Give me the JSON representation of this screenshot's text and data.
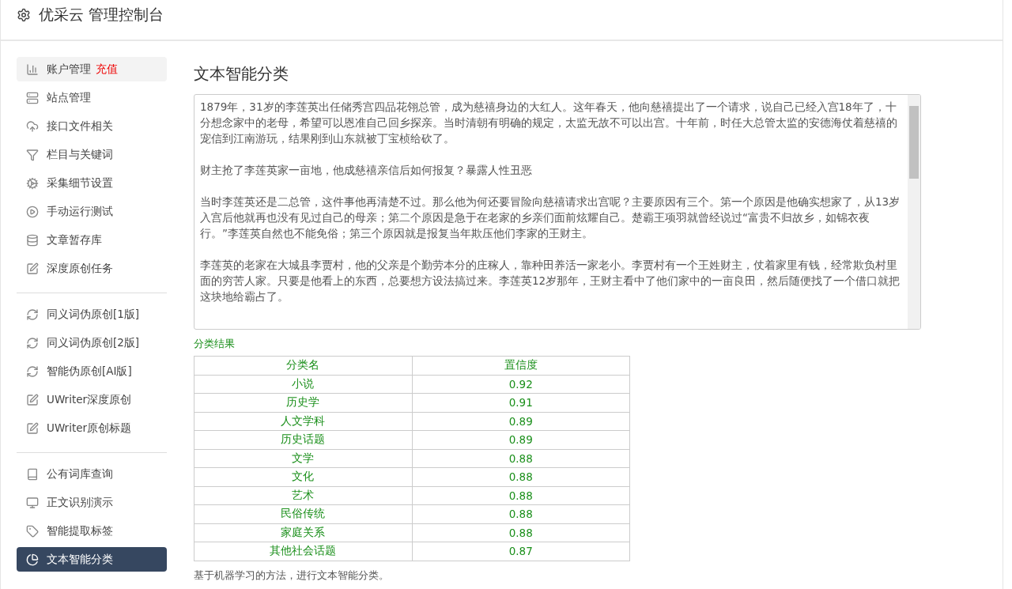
{
  "header": {
    "title": "优采云 管理控制台"
  },
  "sidebar": {
    "groups": [
      [
        {
          "label": "账户管理",
          "badge": "充值",
          "selected": false,
          "highlighted": true
        },
        {
          "label": "站点管理",
          "selected": false,
          "highlighted": false
        },
        {
          "label": "接口文件相关",
          "selected": false,
          "highlighted": false
        },
        {
          "label": "栏目与关键词",
          "selected": false,
          "highlighted": false
        },
        {
          "label": "采集细节设置",
          "selected": false,
          "highlighted": false
        },
        {
          "label": "手动运行测试",
          "selected": false,
          "highlighted": false
        },
        {
          "label": "文章暂存库",
          "selected": false,
          "highlighted": false
        },
        {
          "label": "深度原创任务",
          "selected": false,
          "highlighted": false
        }
      ],
      [
        {
          "label": "同义词伪原创[1版]",
          "selected": false,
          "highlighted": false
        },
        {
          "label": "同义词伪原创[2版]",
          "selected": false,
          "highlighted": false
        },
        {
          "label": "智能伪原创[AI版]",
          "selected": false,
          "highlighted": false
        },
        {
          "label": "UWriter深度原创",
          "selected": false,
          "highlighted": false
        },
        {
          "label": "UWriter原创标题",
          "selected": false,
          "highlighted": false
        }
      ],
      [
        {
          "label": "公有词库查询",
          "selected": false,
          "highlighted": false
        },
        {
          "label": "正文识别演示",
          "selected": false,
          "highlighted": false
        },
        {
          "label": "智能提取标签",
          "selected": false,
          "highlighted": false
        },
        {
          "label": "文本智能分类",
          "selected": true,
          "highlighted": false
        }
      ]
    ]
  },
  "main": {
    "title": "文本智能分类",
    "text_input": {
      "paragraphs": [
        "1879年，31岁的李莲英出任储秀宫四品花翎总管，成为慈禧身边的大红人。这年春天，他向慈禧提出了一个请求，说自己已经入宫18年了，十分想念家中的老母，希望可以恩准自己回乡探亲。当时清朝有明确的规定，太监无故不可以出宫。十年前，时任大总管太监的安德海仗着慈禧的宠信到江南游玩，结果刚到山东就被丁宝桢给砍了。",
        "财主抢了李莲英家一亩地，他成慈禧亲信后如何报复？暴露人性丑恶",
        "当时李莲英还是二总管，这件事他再清楚不过。那么他为何还要冒险向慈禧请求出宫呢？主要原因有三个。第一个原因是他确实想家了，从13岁入宫后他就再也没有见过自己的母亲；第二个原因是急于在老家的乡亲们面前炫耀自己。楚霸王项羽就曾经说过“富贵不归故乡，如锦衣夜行。”李莲英自然也不能免俗；第三个原因就是报复当年欺压他们李家的王财主。",
        "李莲英的老家在大城县李贾村，他的父亲是个勤劳本分的庄稼人，靠种田养活一家老小。李贾村有一个王姓财主，仗着家里有钱，经常欺负村里面的穷苦人家。只要是他看上的东西，总要想方设法搞过来。李莲英12岁那年，王财主看中了他们家中的一亩良田，然后随便找了一个借口就把这块地给霸占了。"
      ]
    },
    "result_label": "分类结果",
    "table": {
      "columns": [
        "分类名",
        "置信度"
      ],
      "rows": [
        [
          "小说",
          "0.92"
        ],
        [
          "历史学",
          "0.91"
        ],
        [
          "人文学科",
          "0.89"
        ],
        [
          "历史话题",
          "0.89"
        ],
        [
          "文学",
          "0.88"
        ],
        [
          "文化",
          "0.88"
        ],
        [
          "艺术",
          "0.88"
        ],
        [
          "民俗传统",
          "0.88"
        ],
        [
          "家庭关系",
          "0.88"
        ],
        [
          "其他社会话题",
          "0.87"
        ]
      ]
    },
    "note": "基于机器学习的方法，进行文本智能分类。"
  }
}
